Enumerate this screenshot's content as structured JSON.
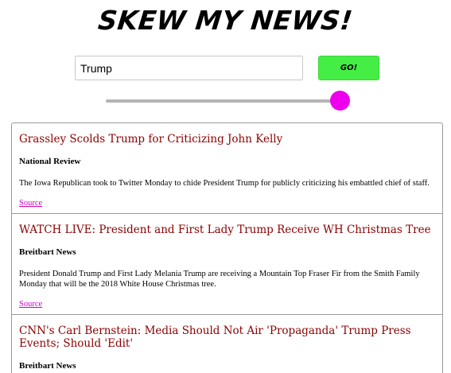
{
  "header": {
    "logo_text": "SKEW MY NEWS!"
  },
  "search": {
    "value": "Trump",
    "go_label": "GO!"
  },
  "slider": {
    "position_fraction": 0.96
  },
  "colors": {
    "go_button": "#44ee44",
    "slider_thumb": "#ee00ee",
    "title": "#8b0000",
    "link": "#cc00cc"
  },
  "articles": [
    {
      "title": "Grassley Scolds Trump for Criticizing John Kelly",
      "source": "National Review",
      "description": "The Iowa Republican took to Twitter Monday to chide President Trump for publicly criticizing his embattled chief of staff.",
      "link_label": "Source"
    },
    {
      "title": "WATCH LIVE: President and First Lady Trump Receive WH Christmas Tree",
      "source": "Breitbart News",
      "description": "President Donald Trump and First Lady Melania Trump are receiving a Mountain Top Fraser Fir from the Smith Family Monday that will be the 2018 White House Christmas tree.",
      "link_label": "Source"
    },
    {
      "title": "CNN's Carl Bernstein: Media Should Not Air 'Propaganda' Trump Press Events; Should 'Edit'",
      "source": "Breitbart News",
      "description": "",
      "link_label": ""
    }
  ]
}
